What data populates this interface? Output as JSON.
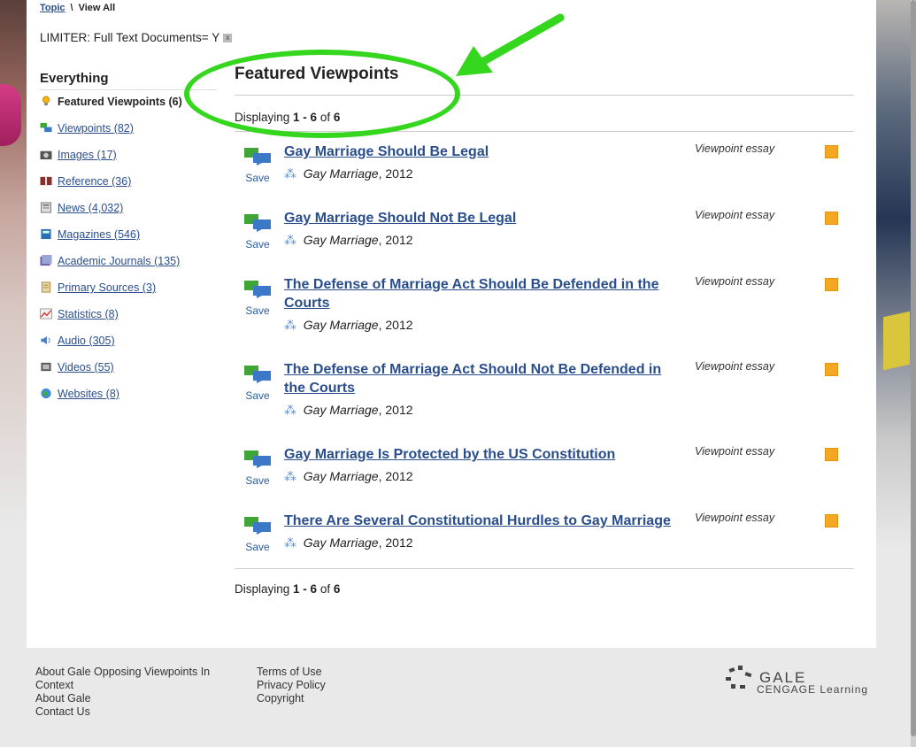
{
  "breadcrumb": {
    "topic": "Topic",
    "separator": "\\",
    "current": "View All"
  },
  "limiter": {
    "text": "LIMITER: Full Text Documents= Y",
    "remove": "x"
  },
  "sidebar": {
    "heading": "Everything",
    "items": [
      {
        "label": "Featured Viewpoints (6)",
        "icon": "lightbulb-icon"
      },
      {
        "label": "Viewpoints (82)",
        "icon": "viewpoints-icon"
      },
      {
        "label": "Images (17)",
        "icon": "camera-icon"
      },
      {
        "label": "Reference (36)",
        "icon": "book-icon"
      },
      {
        "label": "News (4,032)",
        "icon": "newspaper-icon"
      },
      {
        "label": "Magazines (546)",
        "icon": "magazine-icon"
      },
      {
        "label": "Academic Journals (135)",
        "icon": "journal-icon"
      },
      {
        "label": "Primary Sources (3)",
        "icon": "scroll-icon"
      },
      {
        "label": "Statistics (8)",
        "icon": "chart-icon"
      },
      {
        "label": "Audio (305)",
        "icon": "speaker-icon"
      },
      {
        "label": "Videos (55)",
        "icon": "video-icon"
      },
      {
        "label": "Websites (8)",
        "icon": "globe-icon"
      }
    ]
  },
  "content": {
    "heading": "Featured Viewpoints",
    "displaying": {
      "prefix": "Displaying",
      "range": "1 - 6",
      "of": "of",
      "total": "6"
    },
    "save_label": "Save",
    "results": [
      {
        "title": "Gay Marriage Should Be Legal",
        "source": "Gay Marriage",
        "year": ", 2012",
        "type": "Viewpoint essay"
      },
      {
        "title": "Gay Marriage Should Not Be Legal",
        "source": "Gay Marriage",
        "year": ", 2012",
        "type": "Viewpoint essay"
      },
      {
        "title": "The Defense of Marriage Act Should Be Defended in the Courts",
        "source": "Gay Marriage",
        "year": ", 2012",
        "type": "Viewpoint essay"
      },
      {
        "title": "The Defense of Marriage Act Should Not Be Defended in the Courts",
        "source": "Gay Marriage",
        "year": ", 2012",
        "type": "Viewpoint essay"
      },
      {
        "title": "Gay Marriage Is Protected by the US Constitution",
        "source": "Gay Marriage",
        "year": ", 2012",
        "type": "Viewpoint essay"
      },
      {
        "title": "There Are Several Constitutional Hurdles to Gay Marriage",
        "source": "Gay Marriage",
        "year": ", 2012",
        "type": "Viewpoint essay"
      }
    ]
  },
  "footer": {
    "col1": [
      "About Gale Opposing Viewpoints In Context",
      "About Gale",
      "Contact Us"
    ],
    "col2": [
      "Terms of Use",
      "Privacy Policy",
      "Copyright"
    ]
  },
  "logo": {
    "name": "GALE",
    "tagline": "CENGAGE Learning"
  },
  "colors": {
    "link": "#2a4e8c",
    "annotation": "#34d61e",
    "flag": "#f5a623"
  }
}
